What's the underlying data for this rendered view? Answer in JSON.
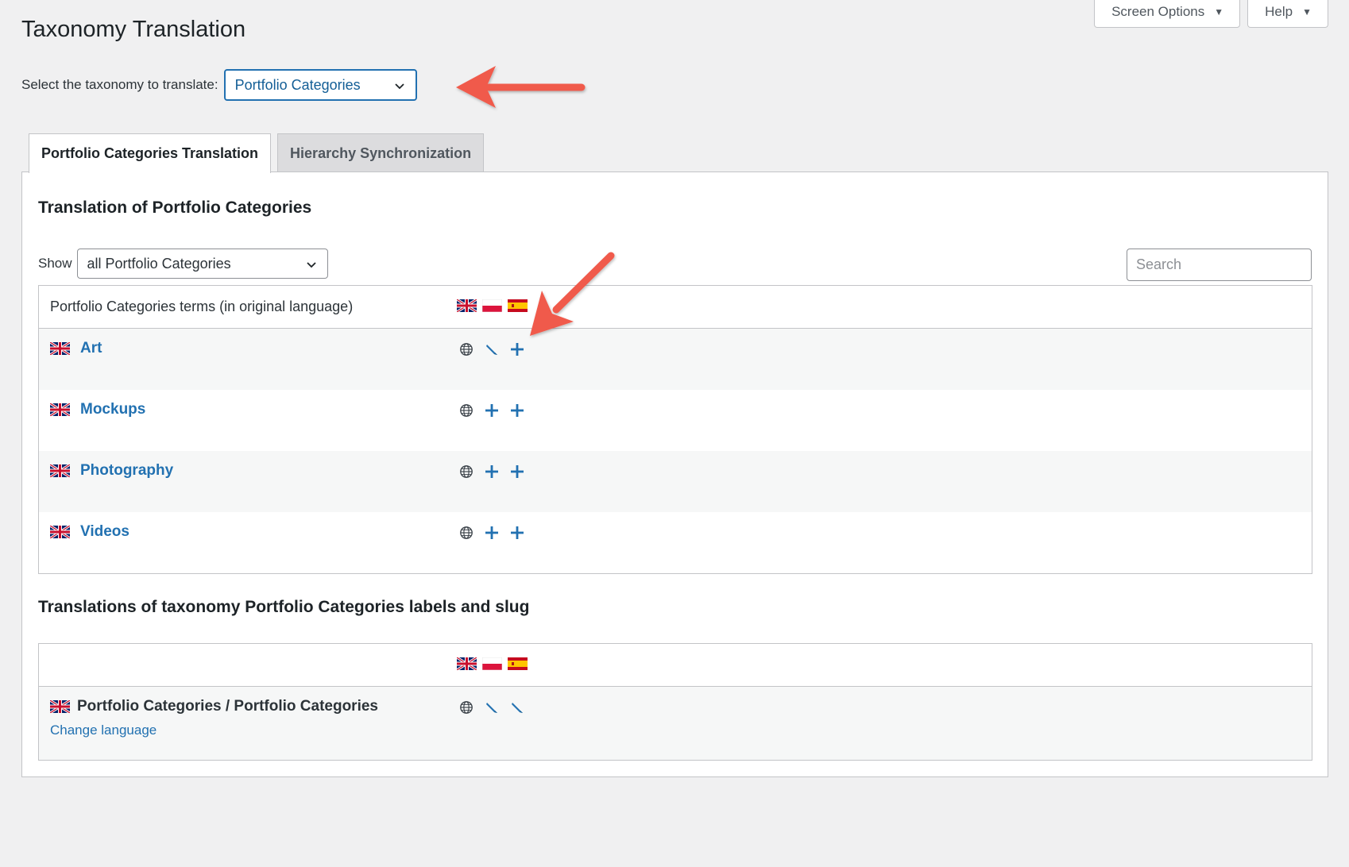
{
  "screen_meta": {
    "screen_options_label": "Screen Options",
    "help_label": "Help",
    "caret": "▼"
  },
  "page": {
    "title": "Taxonomy Translation",
    "select_label": "Select the taxonomy to translate:",
    "selected_taxonomy": "Portfolio Categories"
  },
  "tabs": [
    {
      "label": "Portfolio Categories Translation",
      "active": true
    },
    {
      "label": "Hierarchy Synchronization",
      "active": false
    }
  ],
  "terms_section": {
    "title": "Translation of Portfolio Categories",
    "show_label": "Show",
    "show_value": "all Portfolio Categories",
    "search_placeholder": "Search",
    "table_header": "Portfolio Categories terms (in original language)",
    "header_flags": [
      "uk-flag",
      "poland-flag",
      "spain-flag"
    ],
    "rows": [
      {
        "name": "Art",
        "actions": [
          "globe-icon",
          "pencil-icon",
          "plus-icon"
        ]
      },
      {
        "name": "Mockups",
        "actions": [
          "globe-icon",
          "plus-icon",
          "plus-icon"
        ]
      },
      {
        "name": "Photography",
        "actions": [
          "globe-icon",
          "plus-icon",
          "plus-icon"
        ]
      },
      {
        "name": "Videos",
        "actions": [
          "globe-icon",
          "plus-icon",
          "plus-icon"
        ]
      }
    ]
  },
  "labels_section": {
    "title": "Translations of taxonomy Portfolio Categories labels and slug",
    "header_flags": [
      "uk-flag",
      "poland-flag",
      "spain-flag"
    ],
    "row_name": "Portfolio Categories / Portfolio Categories",
    "change_language": "Change language",
    "actions": [
      "globe-icon",
      "pencil-icon",
      "pencil-icon"
    ]
  },
  "colors": {
    "accent": "#2271b1",
    "annotation_arrow": "#f05a4b",
    "background": "#f0f0f1"
  }
}
